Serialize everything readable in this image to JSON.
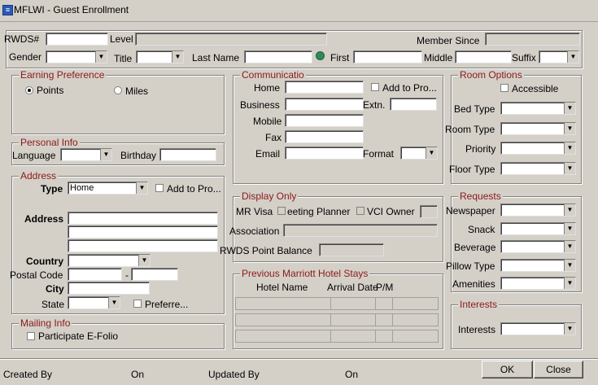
{
  "window": {
    "title": "MFLWI - Guest Enrollment",
    "icon": "app-icon"
  },
  "top": {
    "rwds_label": "RWDS#",
    "level_label": "Level",
    "member_since_label": "Member Since",
    "gender_label": "Gender",
    "title_label": "Title",
    "last_name_label": "Last Name",
    "first_label": "First",
    "middle_label": "Middle",
    "suffix_label": "Suffix"
  },
  "earning": {
    "title": "Earning Preference",
    "points": "Points",
    "miles": "Miles",
    "selected": "Points"
  },
  "personal": {
    "title": "Personal Info",
    "language_label": "Language",
    "birthday_label": "Birthday"
  },
  "address": {
    "title": "Address",
    "type_label": "Type",
    "type_value": "Home",
    "add_to_pro": "Add to Pro...",
    "address_label": "Address",
    "country_label": "Country",
    "postal_label": "Postal Code",
    "postal_sep": "-",
    "city_label": "City",
    "state_label": "State",
    "preferred": "Preferre..."
  },
  "mailing": {
    "title": "Mailing Info",
    "participate": "Participate E-Folio"
  },
  "comm": {
    "title": "Communicatio",
    "home": "Home",
    "add_to_pro": "Add to Pro...",
    "business": "Business",
    "extn": "Extn.",
    "mobile": "Mobile",
    "fax": "Fax",
    "email": "Email",
    "format": "Format"
  },
  "display": {
    "title": "Display Only",
    "mr_visa": "MR Visa",
    "meeting_planner": "eeting Planner",
    "vci_owner": "VCI Owner",
    "association": "Association",
    "rwds_balance": "RWDS Point Balance"
  },
  "stays": {
    "title": "Previous Marriott Hotel Stays",
    "columns": [
      "Hotel Name",
      "Arrival Date",
      "P/M"
    ]
  },
  "room": {
    "title": "Room Options",
    "accessible": "Accessible",
    "bed_type": "Bed Type",
    "room_type": "Room Type",
    "priority": "Priority",
    "floor_type": "Floor Type"
  },
  "requests": {
    "title": "Requests",
    "newspaper": "Newspaper",
    "snack": "Snack",
    "beverage": "Beverage",
    "pillow": "Pillow Type",
    "amenities": "Amenities"
  },
  "interests": {
    "title": "Interests",
    "interests_label": "Interests"
  },
  "footer": {
    "created_by": "Created By",
    "on1": "On",
    "updated_by": "Updated By",
    "on2": "On"
  },
  "buttons": {
    "ok": "OK",
    "close": "Close"
  }
}
